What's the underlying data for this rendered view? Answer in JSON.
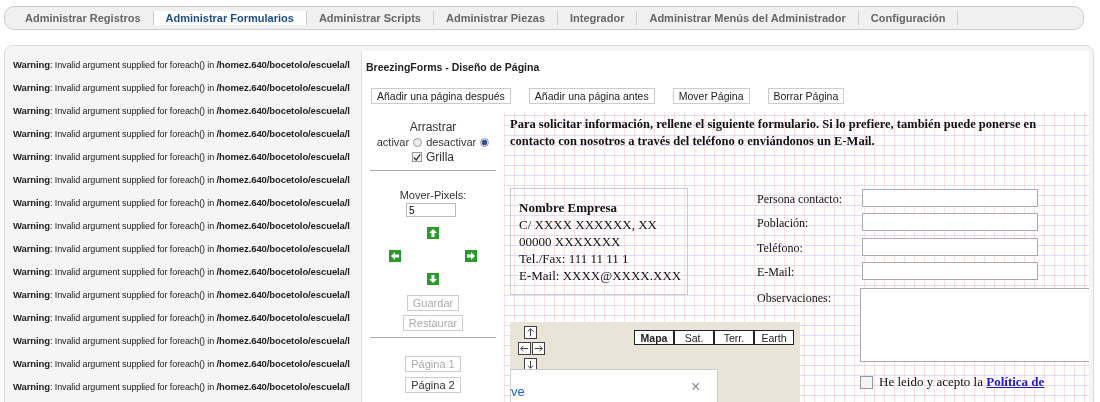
{
  "nav": {
    "items": [
      {
        "label": "Administrar Registros",
        "selected": false
      },
      {
        "label": "Administrar Formularios",
        "selected": true
      },
      {
        "label": "Administrar Scripts",
        "selected": false
      },
      {
        "label": "Administrar Piezas",
        "selected": false
      },
      {
        "label": "Integrador",
        "selected": false
      },
      {
        "label": "Administrar Menús del Administrador",
        "selected": false
      },
      {
        "label": "Configuración",
        "selected": false
      }
    ]
  },
  "warnings": [
    "**Warning**: Invalid argument supplied for foreach() in **/homez.640/bocetolo/escuela/l**",
    "**Warning**: Invalid argument supplied for foreach() in **/homez.640/bocetolo/escuela/l**",
    "**Warning**: Invalid argument supplied for foreach() in **/homez.640/bocetolo/escuela/l**",
    "**Warning**: Invalid argument supplied for foreach() in **/homez.640/bocetolo/escuela/l**",
    "**Warning**: Invalid argument supplied for foreach() in **/homez.640/bocetolo/escuela/l**",
    "**Warning**: Invalid argument supplied for foreach() in **/homez.640/bocetolo/escuela/l**",
    "**Warning**: Invalid argument supplied for foreach() in **/homez.640/bocetolo/escuela/l**",
    "**Warning**: Invalid argument supplied for foreach() in **/homez.640/bocetolo/escuela/l**",
    "**Warning**: Invalid argument supplied for foreach() in **/homez.640/bocetolo/escuela/l**",
    "**Warning**: Invalid argument supplied for foreach() in **/homez.640/bocetolo/escuela/l**",
    "**Warning**: Invalid argument supplied for foreach() in **/homez.640/bocetolo/escuela/l**",
    "**Warning**: Invalid argument supplied for foreach() in **/homez.640/bocetolo/escuela/l**",
    "**Warning**: Invalid argument supplied for foreach() in **/homez.640/bocetolo/escuela/l**",
    "**Warning**: Invalid argument supplied for foreach() in **/homez.640/bocetolo/escuela/l**",
    "**Warning**: Invalid argument supplied for foreach() in **/homez.640/bocetolo/escuela/l**"
  ],
  "dialog": {
    "title": "BreezingForms - Diseño de Página",
    "buttons": [
      "Añadir una página después",
      "Añadir una página antes",
      "Mover Página",
      "Borrar Página"
    ],
    "sidebar": {
      "drag_label": "Arrastrar",
      "radios": [
        {
          "label": "activar",
          "selected": false
        },
        {
          "label": "desactivar",
          "selected": true
        }
      ],
      "grid": {
        "label": "Grilla",
        "checked": true
      },
      "move_label": "Mover-Pixels:",
      "move_value": "5",
      "actions": [
        {
          "label": "Guardar",
          "disabled": true
        },
        {
          "label": "Restaurar",
          "disabled": true
        }
      ],
      "pages": [
        {
          "label": "Página 1",
          "selected": true
        },
        {
          "label": "Página 2",
          "selected": false
        }
      ]
    },
    "canvas": {
      "intro": "Para solicitar información, rellene el siguiente formulario. Si lo prefiere, también puede ponerse en contacto con nosotros a través del teléfono o enviándonos un E-Mail.",
      "address": {
        "name": "Nombre Empresa",
        "lines": [
          "C/ XXXX XXXXXX, XX",
          "00000 XXXXXXX",
          "Tel./Fax: 111 11 11 1",
          "E-Mail: XXXX@XXXX.XXX"
        ]
      },
      "fields": [
        {
          "label": "Persona contacto:",
          "kind": "input"
        },
        {
          "label": "Población:",
          "kind": "input"
        },
        {
          "label": "Teléfono:",
          "kind": "input"
        },
        {
          "label": "E-Mail:",
          "kind": "input"
        },
        {
          "label": "Observaciones:",
          "kind": "textarea"
        }
      ],
      "map": {
        "types": [
          {
            "label": "Mapa",
            "selected": true
          },
          {
            "label": "Sat.",
            "selected": false
          },
          {
            "label": "Terr.",
            "selected": false
          },
          {
            "label": "Earth",
            "selected": false
          }
        ],
        "popup_link": "ve",
        "popup_close": "×"
      },
      "consent": {
        "text": "He leido y acepto la ",
        "link": "Política de",
        "checked": false
      }
    }
  }
}
